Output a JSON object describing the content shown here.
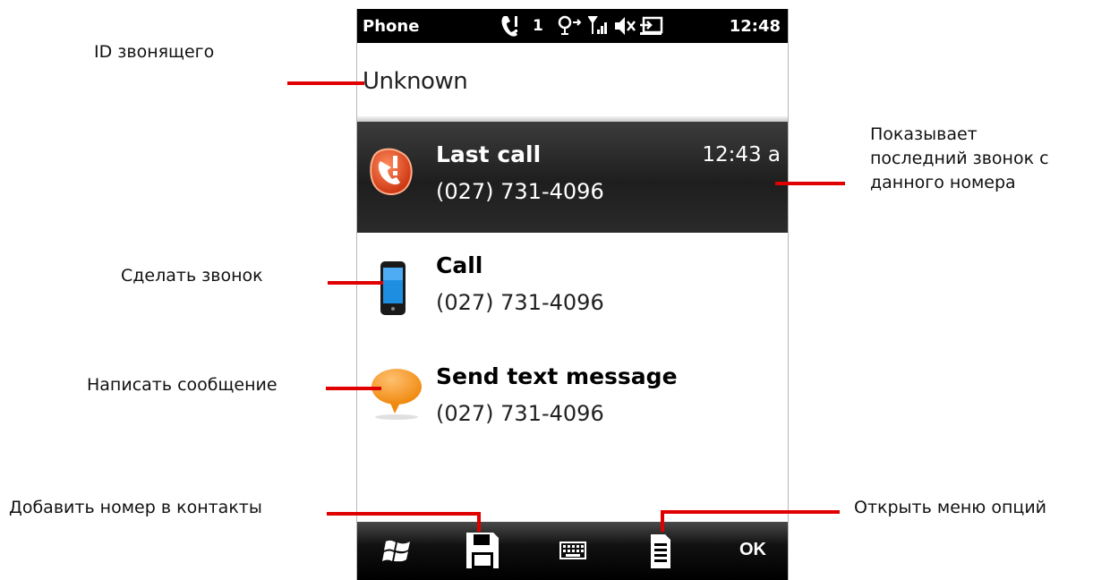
{
  "status_bar": {
    "title": "Phone",
    "line_indicator": "1",
    "time": "12:48"
  },
  "caller_id": "Unknown",
  "entries": [
    {
      "label": "Last call",
      "number": "(027) 731-4096",
      "time": "12:43 a",
      "icon": "missed-call-icon"
    },
    {
      "label": "Call",
      "number": "(027) 731-4096",
      "icon": "phone-icon"
    },
    {
      "label": "Send text message",
      "number": "(027) 731-4096",
      "icon": "message-bubble-icon"
    }
  ],
  "softkeys": {
    "start_icon": "windows-start-icon",
    "save_icon": "save-floppy-icon",
    "keyboard_icon": "keyboard-icon",
    "menu_icon": "menu-list-icon",
    "ok_label": "OK"
  },
  "annotations": {
    "caller_id": "ID звонящего",
    "last_call": [
      "Показывает",
      "последний звонок с",
      "данного номера"
    ],
    "make_call": "Сделать звонок",
    "write_message": "Написать сообщение",
    "add_contact": "Добавить номер в контакты",
    "open_menu": "Открыть меню опций"
  },
  "colors": {
    "annotation_line": "#e00000",
    "status_bar": "#000000",
    "selected_row": "#2a2a2a"
  }
}
